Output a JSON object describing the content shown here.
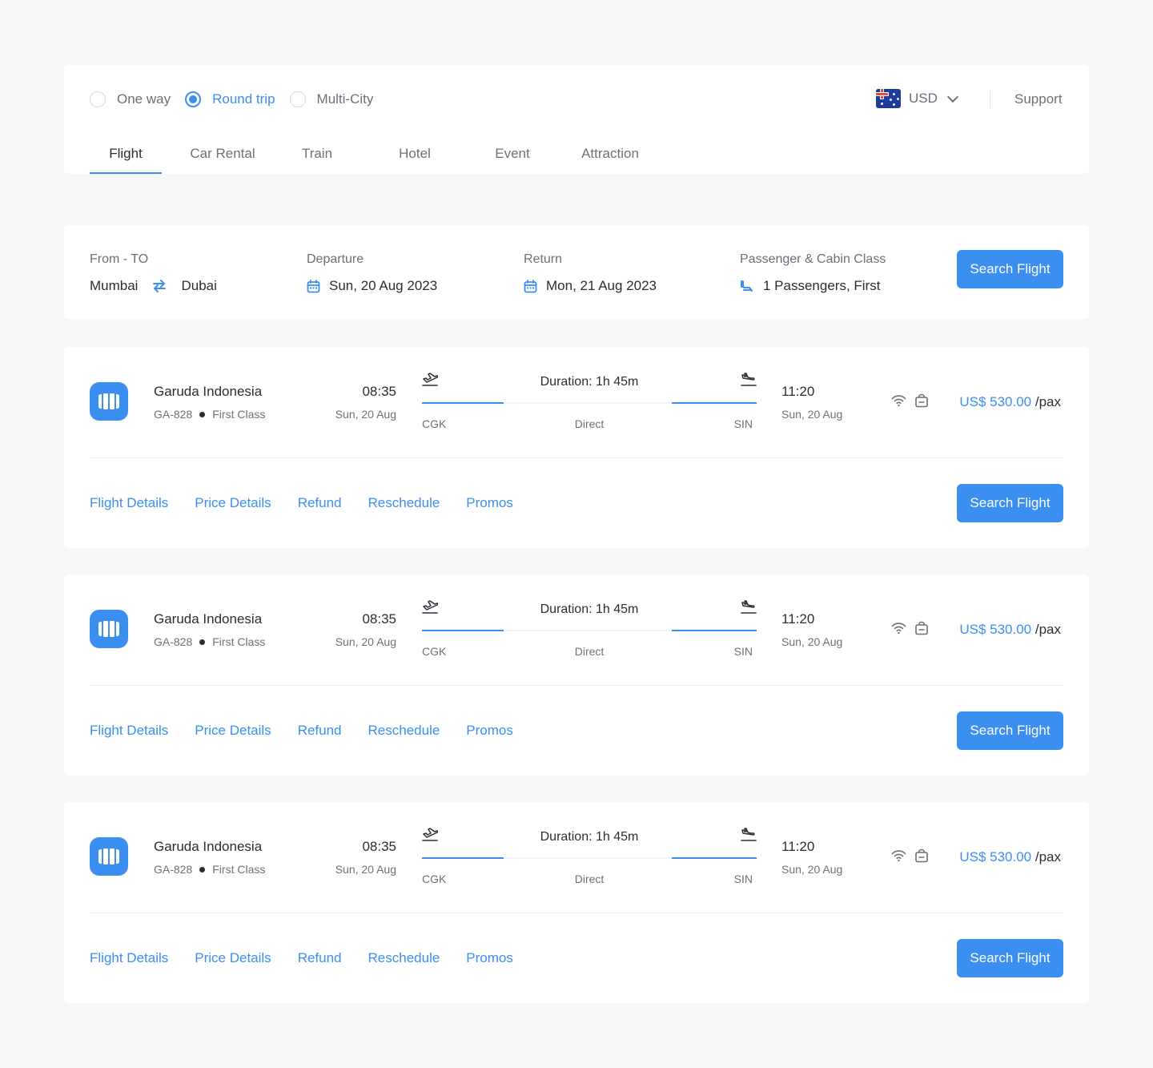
{
  "trip_types": [
    {
      "label": "One way",
      "selected": false
    },
    {
      "label": "Round trip",
      "selected": true
    },
    {
      "label": "Multi-City",
      "selected": false
    }
  ],
  "currency": {
    "code": "USD",
    "flag_icon": "australia-flag-icon"
  },
  "support_label": "Support",
  "tabs": [
    {
      "label": "Flight",
      "active": true
    },
    {
      "label": "Car Rental",
      "active": false
    },
    {
      "label": "Train",
      "active": false
    },
    {
      "label": "Hotel",
      "active": false
    },
    {
      "label": "Event",
      "active": false
    },
    {
      "label": "Attraction",
      "active": false
    }
  ],
  "search": {
    "from_to_label": "From - TO",
    "from": "Mumbai",
    "to": "Dubai",
    "departure_label": "Departure",
    "departure_value": "Sun, 20 Aug 2023",
    "return_label": "Return",
    "return_value": "Mon, 21 Aug 2023",
    "passenger_label": "Passenger & Cabin Class",
    "passenger_value": "1 Passengers, First",
    "button_label": "Search Flight"
  },
  "flights": [
    {
      "airline": "Garuda Indonesia",
      "code": "GA-828",
      "cabin": "First Class",
      "dep_time": "08:35",
      "dep_date": "Sun, 20 Aug",
      "duration": "Duration: 1h 45m",
      "from": "CGK",
      "stops": "Direct",
      "to": "SIN",
      "arr_time": "11:20",
      "arr_date": "Sun, 20 Aug",
      "price": "US$ 530.00",
      "per": " /pax",
      "links": [
        "Flight Details",
        "Price Details",
        "Refund",
        "Reschedule",
        "Promos"
      ],
      "button_label": "Search Flight"
    },
    {
      "airline": "Garuda Indonesia",
      "code": "GA-828",
      "cabin": "First Class",
      "dep_time": "08:35",
      "dep_date": "Sun, 20 Aug",
      "duration": "Duration: 1h 45m",
      "from": "CGK",
      "stops": "Direct",
      "to": "SIN",
      "arr_time": "11:20",
      "arr_date": "Sun, 20 Aug",
      "price": "US$ 530.00",
      "per": " /pax",
      "links": [
        "Flight Details",
        "Price Details",
        "Refund",
        "Reschedule",
        "Promos"
      ],
      "button_label": "Search Flight"
    },
    {
      "airline": "Garuda Indonesia",
      "code": "GA-828",
      "cabin": "First Class",
      "dep_time": "08:35",
      "dep_date": "Sun, 20 Aug",
      "duration": "Duration: 1h 45m",
      "from": "CGK",
      "stops": "Direct",
      "to": "SIN",
      "arr_time": "11:20",
      "arr_date": "Sun, 20 Aug",
      "price": "US$ 530.00",
      "per": " /pax",
      "links": [
        "Flight Details",
        "Price Details",
        "Refund",
        "Reschedule",
        "Promos"
      ],
      "button_label": "Search Flight"
    }
  ],
  "colors": {
    "accent": "#3b8ff0",
    "background": "#f6f7f9",
    "text": "#2a2d34",
    "muted": "#6b7079"
  }
}
